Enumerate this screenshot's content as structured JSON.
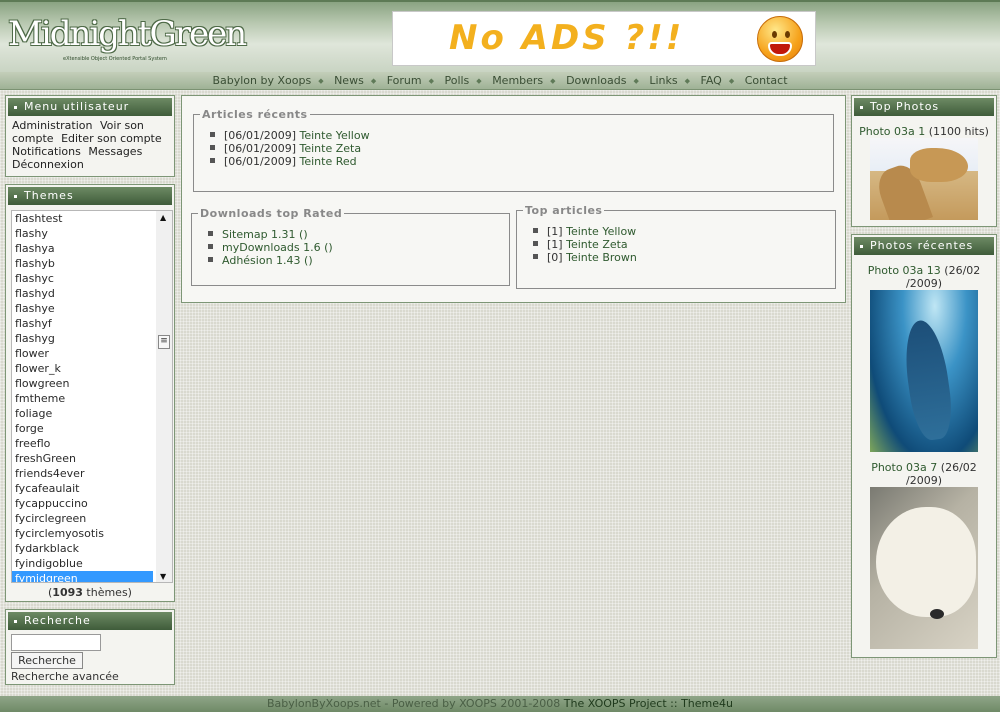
{
  "site": {
    "logo_text": "MidnightGreen",
    "logo_tagline": "eXtensible Object Oriented Portal System",
    "banner_text": "No ADS ?!!"
  },
  "nav": {
    "items": [
      "Babylon by Xoops",
      "News",
      "Forum",
      "Polls",
      "Members",
      "Downloads",
      "Links",
      "FAQ",
      "Contact"
    ]
  },
  "user_menu": {
    "title": "Menu utilisateur",
    "items": [
      "Administration",
      "Voir son compte",
      "Editer son compte",
      "Notifications",
      "Messages",
      "Déconnexion"
    ]
  },
  "themes": {
    "title": "Themes",
    "options": [
      "flashtest",
      "flashy",
      "flashya",
      "flashyb",
      "flashyc",
      "flashyd",
      "flashye",
      "flashyf",
      "flashyg",
      "flower",
      "flower_k",
      "flowgreen",
      "fmtheme",
      "foliage",
      "forge",
      "freeflo",
      "freshGreen",
      "friends4ever",
      "fycafeaulait",
      "fycappuccino",
      "fycirclegreen",
      "fycirclemyosotis",
      "fydarkblack",
      "fyindigoblue",
      "fymidgreen"
    ],
    "selected": "fymidgreen",
    "count_prefix": "(",
    "count": "1093",
    "count_suffix": " thèmes)"
  },
  "search": {
    "title": "Recherche",
    "input_value": "",
    "button_label": "Recherche",
    "advanced_label": "Recherche avancée"
  },
  "articles": {
    "title": "Articles récents",
    "items": [
      {
        "date": "[06/01/2009]",
        "label": "Teinte Yellow"
      },
      {
        "date": "[06/01/2009]",
        "label": "Teinte Zeta"
      },
      {
        "date": "[06/01/2009]",
        "label": "Teinte Red"
      }
    ]
  },
  "downloads": {
    "title": "Downloads top Rated",
    "items": [
      "Sitemap 1.31 ()",
      "myDownloads 1.6 ()",
      "Adhésion 1.43 ()"
    ]
  },
  "top_articles": {
    "title": "Top articles",
    "items": [
      {
        "rank": "[1]",
        "label": "Teinte Yellow"
      },
      {
        "rank": "[1]",
        "label": "Teinte Zeta"
      },
      {
        "rank": "[0]",
        "label": "Teinte Brown"
      }
    ]
  },
  "top_photos": {
    "title": "Top Photos",
    "caption_link": "Photo 03a 1",
    "caption_meta": " (1100 hits)"
  },
  "recent_photos": {
    "title": "Photos récentes",
    "photos": [
      {
        "link": "Photo 03a 13",
        "meta_line1": " (26/02",
        "meta_line2": "/2009)"
      },
      {
        "link": "Photo 03a 7",
        "meta_line1": " (26/02",
        "meta_line2": "/2009)"
      }
    ]
  },
  "footer": {
    "text": "BabylonByXoops.net - Powered by XOOPS 2001-2008 ",
    "project_link": "The XOOPS Project",
    "separator": " :: ",
    "theme_credit": "Theme4u"
  }
}
